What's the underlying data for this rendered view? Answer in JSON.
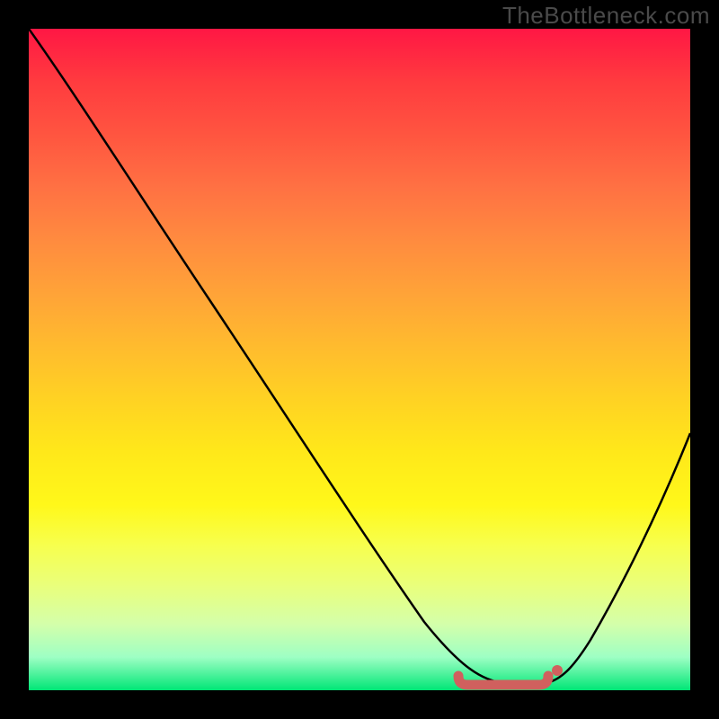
{
  "watermark": "TheBottleneck.com",
  "chart_data": {
    "type": "line",
    "title": "",
    "xlabel": "",
    "ylabel": "",
    "xlim": [
      0,
      100
    ],
    "ylim": [
      0,
      100
    ],
    "gradient_colors": {
      "top": "#ff1744",
      "mid": "#ffeb3b",
      "bottom": "#00e676"
    },
    "series": [
      {
        "name": "bottleneck-curve",
        "x": [
          0,
          10,
          20,
          30,
          40,
          50,
          55,
          60,
          65,
          70,
          73,
          78,
          80,
          85,
          90,
          95,
          100
        ],
        "y": [
          100,
          85,
          70,
          55,
          40,
          26,
          19,
          12,
          6,
          2,
          0,
          0,
          2,
          9,
          20,
          34,
          50
        ]
      }
    ],
    "valley_marker": {
      "name": "optimal-range",
      "color": "#d0605e",
      "x_start": 65,
      "x_end": 80,
      "y": 0
    }
  }
}
